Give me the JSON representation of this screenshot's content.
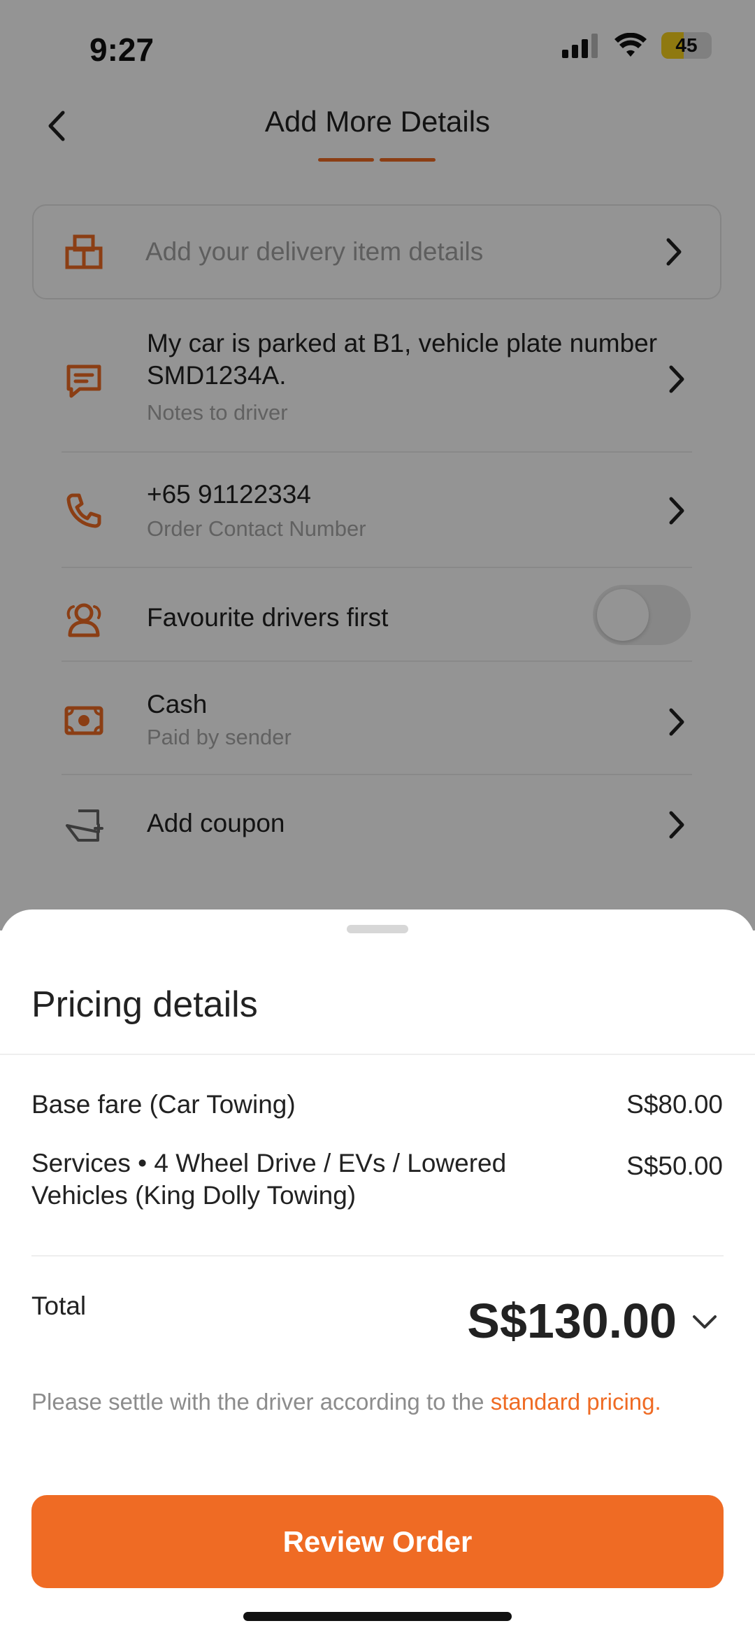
{
  "status_bar": {
    "time": "9:27",
    "battery": "45"
  },
  "header": {
    "title": "Add More Details",
    "back_icon": "chevron-left-icon"
  },
  "item_details": {
    "placeholder": "Add your delivery item details",
    "icon": "package-icon"
  },
  "notes": {
    "text": "My car is parked at B1, vehicle plate number SMD1234A.",
    "label": "Notes to driver",
    "icon": "message-icon"
  },
  "contact": {
    "number": "+65 91122334",
    "label": "Order Contact Number",
    "icon": "phone-icon"
  },
  "favourite": {
    "label": "Favourite drivers first",
    "enabled": false,
    "icon": "users-icon"
  },
  "payment": {
    "method": "Cash",
    "label": "Paid by sender",
    "icon": "cash-icon"
  },
  "coupon": {
    "label": "Add coupon",
    "icon": "coupon-icon"
  },
  "pricing": {
    "title": "Pricing details",
    "lines": [
      {
        "label": "Base fare (Car Towing)",
        "amount": "S$80.00"
      },
      {
        "label": "Services • 4 Wheel Drive / EVs / Lowered Vehicles (King Dolly Towing)",
        "amount": "S$50.00"
      }
    ],
    "total_label": "Total",
    "total_amount": "S$130.00",
    "note_prefix": "Please settle with the driver according to the ",
    "note_link": "standard pricing."
  },
  "cta": {
    "label": "Review Order"
  },
  "colors": {
    "accent": "#ef6b24",
    "overlay": "rgba(0,0,0,0.42)"
  }
}
